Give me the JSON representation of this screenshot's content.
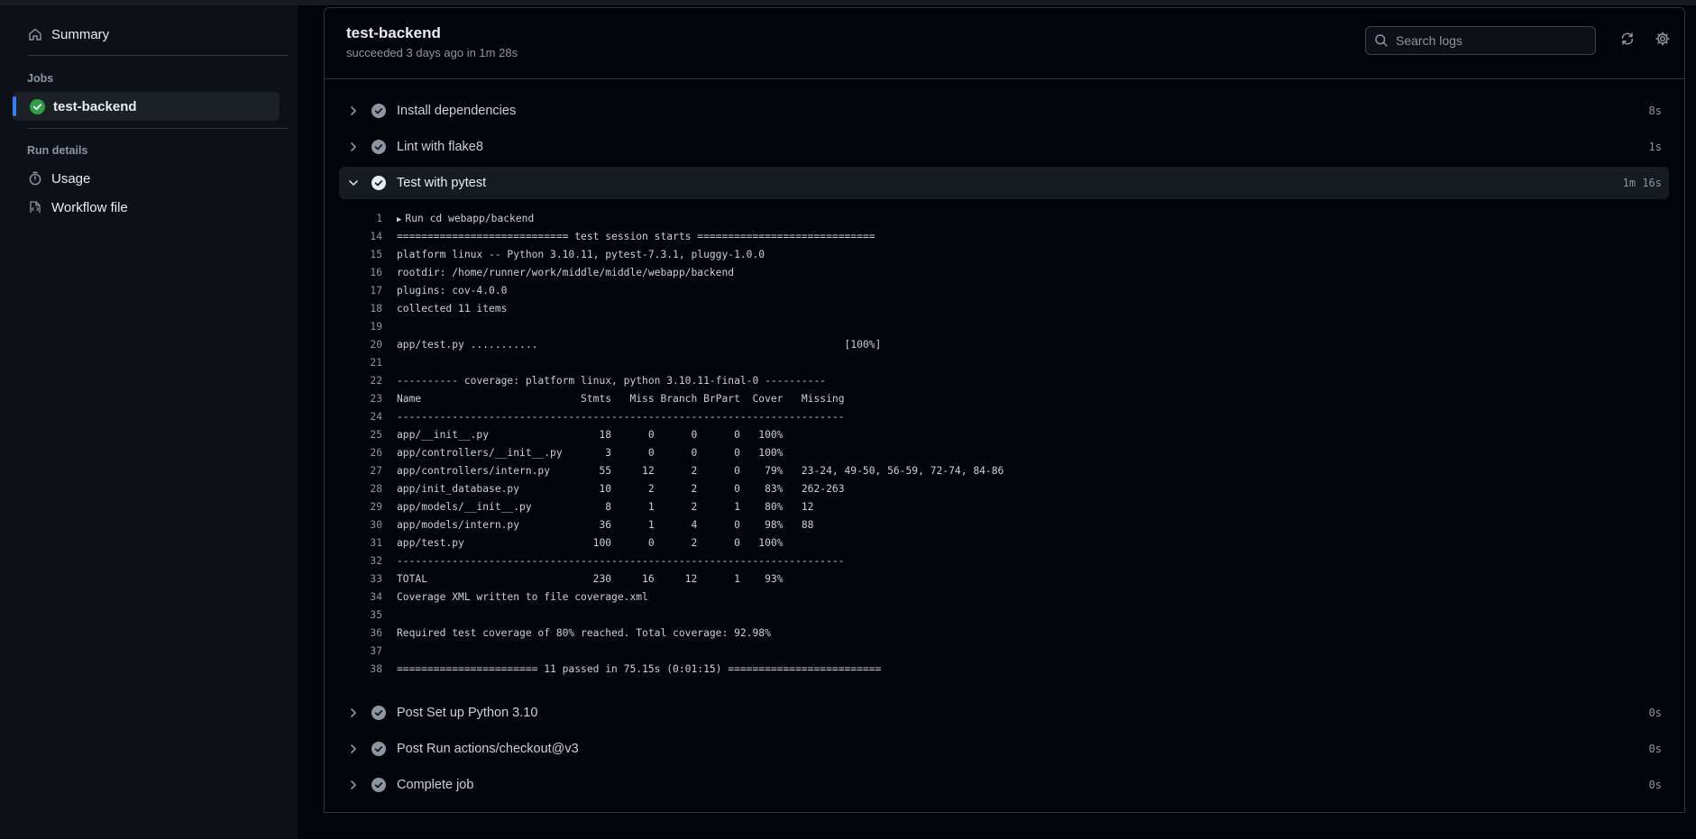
{
  "sidebar": {
    "summary_label": "Summary",
    "jobs_heading": "Jobs",
    "job_label": "test-backend",
    "run_details_heading": "Run details",
    "usage_label": "Usage",
    "workflow_label": "Workflow file"
  },
  "header": {
    "title": "test-backend",
    "subtitle": "succeeded 3 days ago in 1m 28s",
    "search_placeholder": "Search logs"
  },
  "steps": [
    {
      "label": "Install dependencies",
      "duration": "8s",
      "expanded": false
    },
    {
      "label": "Lint with flake8",
      "duration": "1s",
      "expanded": false
    },
    {
      "label": "Test with pytest",
      "duration": "1m 16s",
      "expanded": true
    },
    {
      "label": "Post Set up Python 3.10",
      "duration": "0s",
      "expanded": false
    },
    {
      "label": "Post Run actions/checkout@v3",
      "duration": "0s",
      "expanded": false
    },
    {
      "label": "Complete job",
      "duration": "0s",
      "expanded": false
    }
  ],
  "log_lines": [
    {
      "num": "1",
      "text": "Run cd webapp/backend",
      "collapsible": true
    },
    {
      "num": "14",
      "text": "============================ test session starts ============================="
    },
    {
      "num": "15",
      "text": "platform linux -- Python 3.10.11, pytest-7.3.1, pluggy-1.0.0"
    },
    {
      "num": "16",
      "text": "rootdir: /home/runner/work/middle/middle/webapp/backend"
    },
    {
      "num": "17",
      "text": "plugins: cov-4.0.0"
    },
    {
      "num": "18",
      "text": "collected 11 items"
    },
    {
      "num": "19",
      "text": ""
    },
    {
      "num": "20",
      "text": "app/test.py ...........                                                  [100%]"
    },
    {
      "num": "21",
      "text": ""
    },
    {
      "num": "22",
      "text": "---------- coverage: platform linux, python 3.10.11-final-0 ----------"
    },
    {
      "num": "23",
      "text": "Name                          Stmts   Miss Branch BrPart  Cover   Missing"
    },
    {
      "num": "24",
      "text": "-------------------------------------------------------------------------"
    },
    {
      "num": "25",
      "text": "app/__init__.py                  18      0      0      0   100%"
    },
    {
      "num": "26",
      "text": "app/controllers/__init__.py       3      0      0      0   100%"
    },
    {
      "num": "27",
      "text": "app/controllers/intern.py        55     12      2      0    79%   23-24, 49-50, 56-59, 72-74, 84-86"
    },
    {
      "num": "28",
      "text": "app/init_database.py             10      2      2      0    83%   262-263"
    },
    {
      "num": "29",
      "text": "app/models/__init__.py            8      1      2      1    80%   12"
    },
    {
      "num": "30",
      "text": "app/models/intern.py             36      1      4      0    98%   88"
    },
    {
      "num": "31",
      "text": "app/test.py                     100      0      2      0   100%"
    },
    {
      "num": "32",
      "text": "-------------------------------------------------------------------------"
    },
    {
      "num": "33",
      "text": "TOTAL                           230     16     12      1    93%"
    },
    {
      "num": "34",
      "text": "Coverage XML written to file coverage.xml"
    },
    {
      "num": "35",
      "text": ""
    },
    {
      "num": "36",
      "text": "Required test coverage of 80% reached. Total coverage: 92.98%"
    },
    {
      "num": "37",
      "text": ""
    },
    {
      "num": "38",
      "text": "======================= 11 passed in 75.15s (0:01:15) ========================="
    }
  ],
  "colors": {
    "success": "#2ea043",
    "accent": "#2f81f7",
    "step_check": "#8d96a0"
  },
  "icons": {
    "summary": "home-icon",
    "job_status": "check-circle-icon",
    "usage": "stopwatch-icon",
    "workflow": "file-code-icon",
    "search": "search-icon",
    "refresh": "sync-icon",
    "settings": "gear-icon"
  }
}
